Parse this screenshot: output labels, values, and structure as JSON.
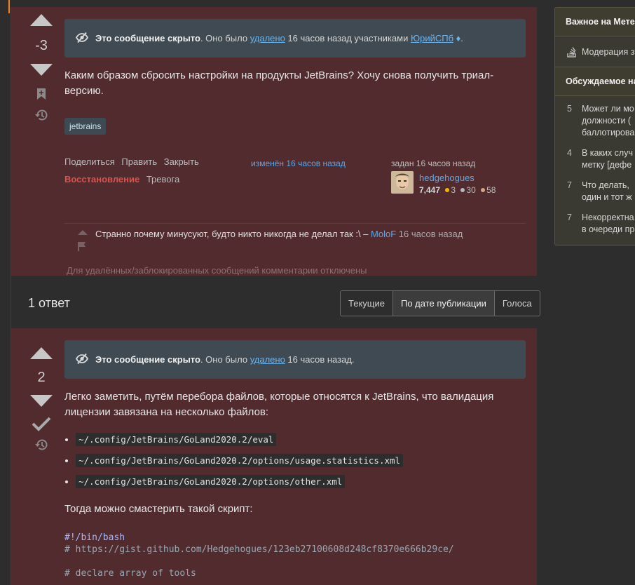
{
  "question": {
    "score": "-3",
    "notice": {
      "bold": "Это сообщение скрыто",
      "pre_link": ". Оно было ",
      "link": "удалено",
      "mid": " 16 часов назад участниками ",
      "user": "ЮрийСПб",
      "diamond": "♦",
      "end": "."
    },
    "body": "Каким образом сбросить настройки на продукты JetBrains? Хочу снова получить триал-версию.",
    "tag": "jetbrains",
    "menu": [
      "Поделиться",
      "Править",
      "Закрыть"
    ],
    "restore": "Восстановление",
    "alarm": "Тревога",
    "edited": "изменён 16 часов назад",
    "asked": "задан 16 часов назад",
    "user": {
      "name": "hedgehogues",
      "rep": "7,447",
      "gold": "3",
      "silver": "30",
      "bronze": "58"
    },
    "comment": {
      "text": "Странно почему минусуют, будто никто никогда не делал так :\\ – ",
      "user": "MoloF",
      "time": " 16 часов назад"
    },
    "comments_disabled": "Для удалённых/заблокированных сообщений комментарии отключены"
  },
  "answers_header": "1 ответ",
  "sort_tabs": [
    "Текущие",
    "По дате публикации",
    "Голоса"
  ],
  "answer": {
    "score": "2",
    "notice": {
      "bold": "Это сообщение скрыто",
      "pre_link": ". Оно было ",
      "link": "удалено",
      "end": " 16 часов назад."
    },
    "intro": "Легко заметить, путём перебора файлов, которые относятся к JetBrains, что валидация лицензии завязана на несколько файлов:",
    "files": [
      "~/.config/JetBrains/GoLand2020.2/eval",
      "~/.config/JetBrains/GoLand2020.2/options/usage.statistics.xml",
      "~/.config/JetBrains/GoLand2020.2/options/other.xml"
    ],
    "script_intro": "Тогда можно смастерить такой скрипт:",
    "code": {
      "line1": "#!/bin/bash",
      "line2": "# https://gist.github.com/Hedgehogues/123eb27100608d248cf8370e666b29ce/",
      "line3": "",
      "line4": "# declare array of tools"
    }
  },
  "sidebar": {
    "meta_title": "Важное на Мете",
    "meta_item": "Модерация з",
    "hot_title": "Обсуждаемое на",
    "hot_items": [
      {
        "num": "5",
        "l1": "Может ли мо",
        "l2": "должности (",
        "l3": "баллотирова"
      },
      {
        "num": "4",
        "l1": "В каких случ",
        "l2": "метку [дефе"
      },
      {
        "num": "7",
        "l1": "Что делать, ",
        "l2": "один и тот ж"
      },
      {
        "num": "7",
        "l1": "Некорректна",
        "l2": "в очереди пр"
      }
    ]
  },
  "colors": {
    "post_bg": "#512b2e",
    "notice_bg": "#3f4a52",
    "link": "#5ba7e8",
    "restore": "#d9534f",
    "gold": "#f1b600",
    "silver": "#b4b8bc",
    "bronze": "#d1a684"
  }
}
